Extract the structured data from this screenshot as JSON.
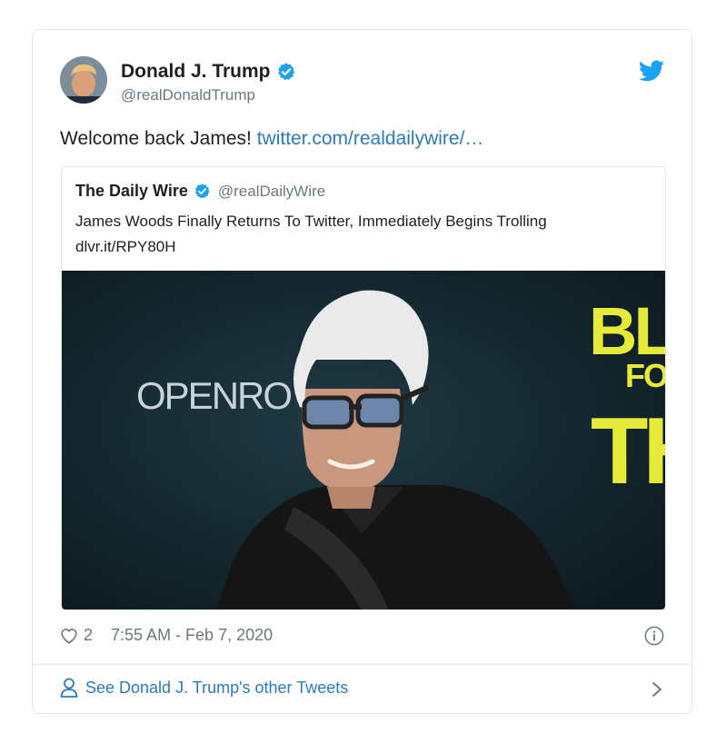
{
  "tweet": {
    "author_name": "Donald J. Trump",
    "author_handle": "@realDonaldTrump",
    "text": "Welcome back James! ",
    "link": "twitter.com/realdailywire/…",
    "likes": "2",
    "timestamp": "7:55 AM - Feb 7, 2020"
  },
  "quote": {
    "author_name": "The Daily Wire",
    "author_handle": "@realDailyWire",
    "text": "James Woods Finally Returns To Twitter, Immediately Begins Trolling dlvr.it/RPY80H",
    "image_sign_left": "OPENRO",
    "image_sign_right_1": "BLE",
    "image_sign_right_2": "FO",
    "image_sign_right_3": "TH"
  },
  "footer": {
    "see_more": "See Donald J. Trump's other Tweets"
  },
  "colors": {
    "link": "#2b7bb9",
    "verified": "#1da1f2",
    "muted": "#697882",
    "border": "#e1e8ed"
  },
  "icons": [
    "verified-badge-icon",
    "twitter-bird-icon",
    "heart-icon",
    "info-icon",
    "person-icon",
    "chevron-right-icon"
  ]
}
